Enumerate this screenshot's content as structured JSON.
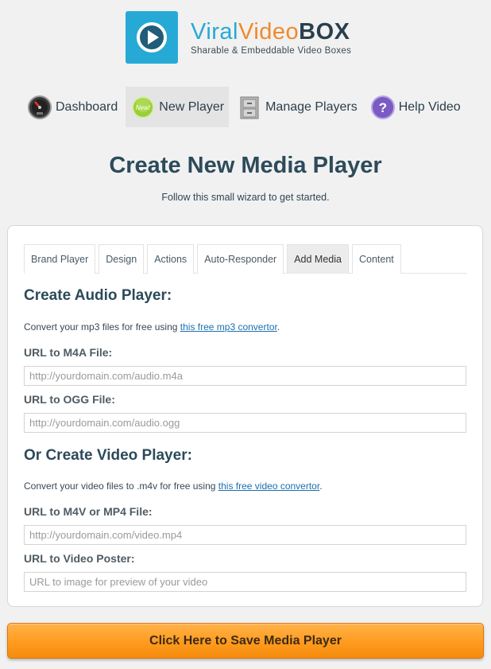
{
  "logo": {
    "word1": "Viral",
    "word2": "Video",
    "word3": "BOX",
    "tagline": "Sharable & Embeddable Video Boxes",
    "icon": "play-icon",
    "colors": {
      "blue": "#27a9d6",
      "orange": "#f08a2c",
      "dark": "#2a3f4d"
    }
  },
  "nav": {
    "items": [
      {
        "label": "Dashboard",
        "icon": "speedometer-icon"
      },
      {
        "label": "New Player",
        "icon": "new-badge-icon",
        "active": true
      },
      {
        "label": "Manage Players",
        "icon": "file-cabinet-icon"
      },
      {
        "label": "Help Video",
        "icon": "question-icon"
      }
    ]
  },
  "page": {
    "title": "Create New Media Player",
    "subtitle": "Follow this small wizard to get started."
  },
  "tabs": [
    {
      "label": "Brand Player"
    },
    {
      "label": "Design"
    },
    {
      "label": "Actions"
    },
    {
      "label": "Auto-Responder"
    },
    {
      "label": "Add Media",
      "active": true
    },
    {
      "label": "Content"
    }
  ],
  "audio": {
    "title": "Create Audio Player:",
    "hint_prefix": "Convert your mp3 files for free using ",
    "hint_link": "this free mp3 convertor",
    "hint_suffix": ".",
    "m4a_label": "URL to M4A File:",
    "m4a_placeholder": "http://yourdomain.com/audio.m4a",
    "m4a_value": "",
    "ogg_label": "URL to OGG File:",
    "ogg_placeholder": "http://yourdomain.com/audio.ogg",
    "ogg_value": ""
  },
  "video": {
    "title": "Or Create Video Player:",
    "hint_prefix": "Convert your video files to .m4v for free using ",
    "hint_link": "this free video convertor",
    "hint_suffix": ".",
    "m4v_label": "URL to M4V or MP4 File:",
    "m4v_placeholder": "http://yourdomain.com/video.mp4",
    "m4v_value": "",
    "poster_label": "URL to Video Poster:",
    "poster_placeholder": "URL to image for preview of your video",
    "poster_value": ""
  },
  "save_button": {
    "label": "Click Here to Save Media Player",
    "color": "#ff9b1e"
  }
}
